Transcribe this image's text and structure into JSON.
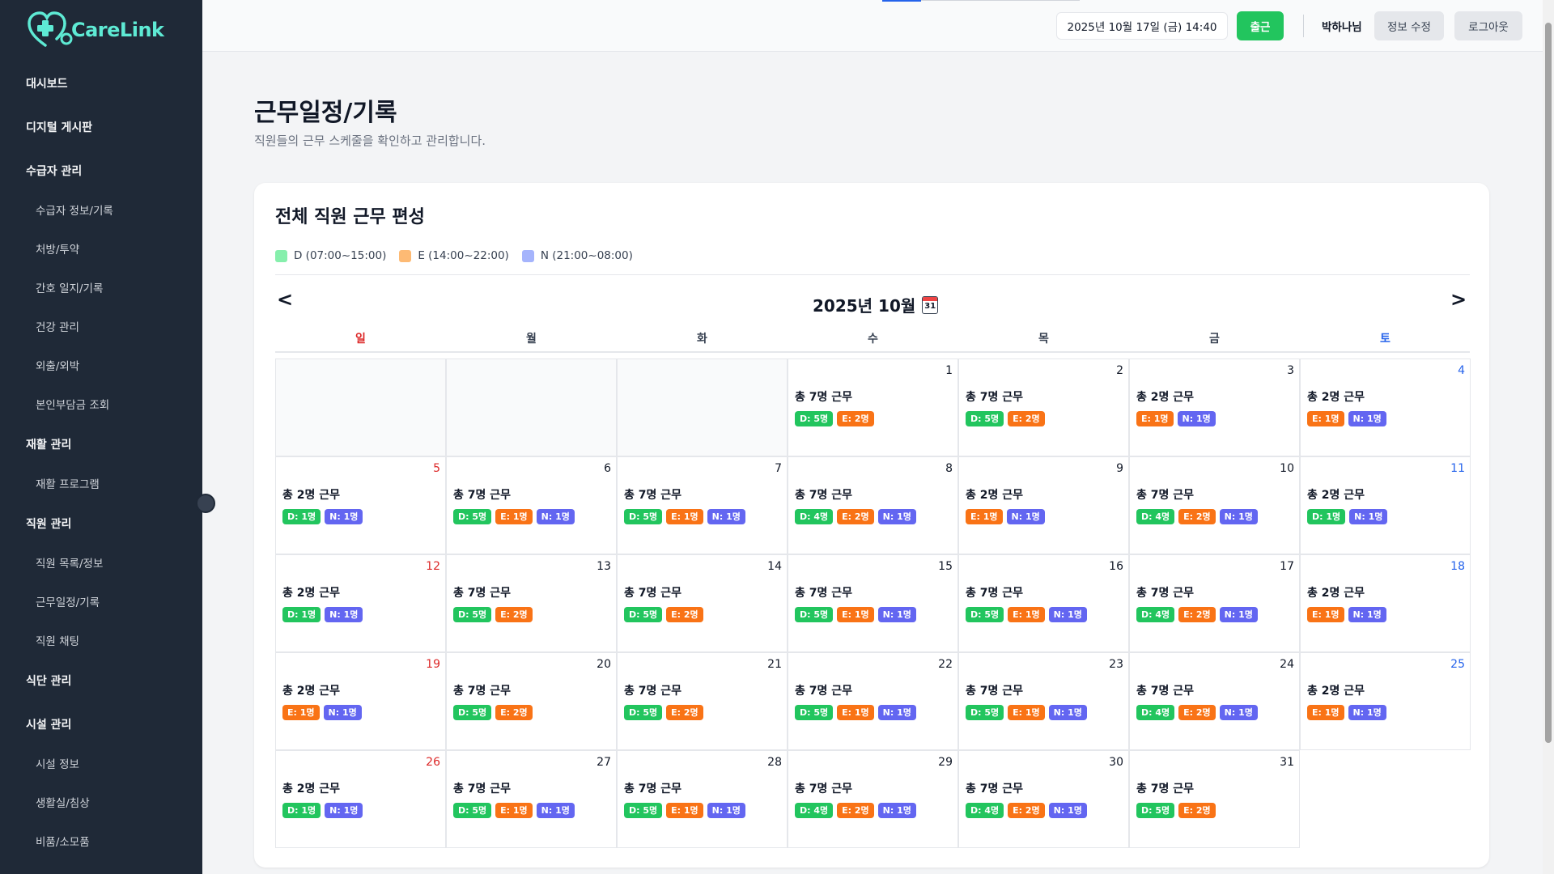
{
  "app": {
    "logo_text": "CareLink"
  },
  "sidebar": {
    "items": [
      {
        "label": "대시보드",
        "level": "top"
      },
      {
        "label": "디지털 게시판",
        "level": "top"
      },
      {
        "label": "수급자 관리",
        "level": "top"
      },
      {
        "label": "수급자 정보/기록",
        "level": "sub"
      },
      {
        "label": "처방/투약",
        "level": "sub"
      },
      {
        "label": "간호 일지/기록",
        "level": "sub"
      },
      {
        "label": "건강 관리",
        "level": "sub"
      },
      {
        "label": "외출/외박",
        "level": "sub"
      },
      {
        "label": "본인부담금 조회",
        "level": "sub"
      },
      {
        "label": "재활 관리",
        "level": "top"
      },
      {
        "label": "재활 프로그램",
        "level": "sub"
      },
      {
        "label": "직원 관리",
        "level": "top"
      },
      {
        "label": "직원 목록/정보",
        "level": "sub"
      },
      {
        "label": "근무일정/기록",
        "level": "sub"
      },
      {
        "label": "직원 채팅",
        "level": "sub"
      },
      {
        "label": "식단 관리",
        "level": "top"
      },
      {
        "label": "시설 관리",
        "level": "top"
      },
      {
        "label": "시설 정보",
        "level": "sub"
      },
      {
        "label": "생활실/침상",
        "level": "sub"
      },
      {
        "label": "비품/소모품",
        "level": "sub"
      }
    ]
  },
  "header": {
    "datetime": "2025년 10월 17일 (금) 14:40",
    "checkin_label": "출근",
    "username": "박하나님",
    "edit_label": "정보 수정",
    "logout_label": "로그아웃"
  },
  "page": {
    "title": "근무일정/기록",
    "subtitle": "직원들의 근무 스케줄을 확인하고 관리합니다."
  },
  "schedule": {
    "card_title": "전체 직원 근무 편성",
    "legend": [
      {
        "label": "D (07:00~15:00)",
        "color": "#86efac"
      },
      {
        "label": "E (14:00~22:00)",
        "color": "#fdba74"
      },
      {
        "label": "N (21:00~08:00)",
        "color": "#a5b4fc"
      }
    ],
    "prev_label": "<",
    "next_label": ">",
    "month_title": "2025년 10월",
    "calendar_icon_num": "31",
    "weekdays": [
      {
        "label": "일",
        "color": "#dc2626"
      },
      {
        "label": "월",
        "color": "#374151"
      },
      {
        "label": "화",
        "color": "#374151"
      },
      {
        "label": "수",
        "color": "#374151"
      },
      {
        "label": "목",
        "color": "#374151"
      },
      {
        "label": "금",
        "color": "#374151"
      },
      {
        "label": "토",
        "color": "#2563eb"
      }
    ],
    "badge_colors": {
      "D": "#22c55e",
      "E": "#f97316",
      "N": "#6366f1"
    },
    "day_colors": {
      "sun": "#dc2626",
      "sat": "#2563eb",
      "weekday": "#111827"
    },
    "leading_empty": 3,
    "days": [
      {
        "day": "1",
        "total": "총 7명 근무",
        "shifts": [
          [
            "D",
            "D: 5명"
          ],
          [
            "E",
            "E: 2명"
          ]
        ]
      },
      {
        "day": "2",
        "total": "총 7명 근무",
        "shifts": [
          [
            "D",
            "D: 5명"
          ],
          [
            "E",
            "E: 2명"
          ]
        ]
      },
      {
        "day": "3",
        "total": "총 2명 근무",
        "shifts": [
          [
            "E",
            "E: 1명"
          ],
          [
            "N",
            "N: 1명"
          ]
        ]
      },
      {
        "day": "4",
        "total": "총 2명 근무",
        "shifts": [
          [
            "E",
            "E: 1명"
          ],
          [
            "N",
            "N: 1명"
          ]
        ]
      },
      {
        "day": "5",
        "total": "총 2명 근무",
        "shifts": [
          [
            "D",
            "D: 1명"
          ],
          [
            "N",
            "N: 1명"
          ]
        ]
      },
      {
        "day": "6",
        "total": "총 7명 근무",
        "shifts": [
          [
            "D",
            "D: 5명"
          ],
          [
            "E",
            "E: 1명"
          ],
          [
            "N",
            "N: 1명"
          ]
        ]
      },
      {
        "day": "7",
        "total": "총 7명 근무",
        "shifts": [
          [
            "D",
            "D: 5명"
          ],
          [
            "E",
            "E: 1명"
          ],
          [
            "N",
            "N: 1명"
          ]
        ]
      },
      {
        "day": "8",
        "total": "총 7명 근무",
        "shifts": [
          [
            "D",
            "D: 4명"
          ],
          [
            "E",
            "E: 2명"
          ],
          [
            "N",
            "N: 1명"
          ]
        ]
      },
      {
        "day": "9",
        "total": "총 2명 근무",
        "shifts": [
          [
            "E",
            "E: 1명"
          ],
          [
            "N",
            "N: 1명"
          ]
        ]
      },
      {
        "day": "10",
        "total": "총 7명 근무",
        "shifts": [
          [
            "D",
            "D: 4명"
          ],
          [
            "E",
            "E: 2명"
          ],
          [
            "N",
            "N: 1명"
          ]
        ]
      },
      {
        "day": "11",
        "total": "총 2명 근무",
        "shifts": [
          [
            "D",
            "D: 1명"
          ],
          [
            "N",
            "N: 1명"
          ]
        ]
      },
      {
        "day": "12",
        "total": "총 2명 근무",
        "shifts": [
          [
            "D",
            "D: 1명"
          ],
          [
            "N",
            "N: 1명"
          ]
        ]
      },
      {
        "day": "13",
        "total": "총 7명 근무",
        "shifts": [
          [
            "D",
            "D: 5명"
          ],
          [
            "E",
            "E: 2명"
          ]
        ]
      },
      {
        "day": "14",
        "total": "총 7명 근무",
        "shifts": [
          [
            "D",
            "D: 5명"
          ],
          [
            "E",
            "E: 2명"
          ]
        ]
      },
      {
        "day": "15",
        "total": "총 7명 근무",
        "shifts": [
          [
            "D",
            "D: 5명"
          ],
          [
            "E",
            "E: 1명"
          ],
          [
            "N",
            "N: 1명"
          ]
        ]
      },
      {
        "day": "16",
        "total": "총 7명 근무",
        "shifts": [
          [
            "D",
            "D: 5명"
          ],
          [
            "E",
            "E: 1명"
          ],
          [
            "N",
            "N: 1명"
          ]
        ]
      },
      {
        "day": "17",
        "total": "총 7명 근무",
        "shifts": [
          [
            "D",
            "D: 4명"
          ],
          [
            "E",
            "E: 2명"
          ],
          [
            "N",
            "N: 1명"
          ]
        ]
      },
      {
        "day": "18",
        "total": "총 2명 근무",
        "shifts": [
          [
            "E",
            "E: 1명"
          ],
          [
            "N",
            "N: 1명"
          ]
        ]
      },
      {
        "day": "19",
        "total": "총 2명 근무",
        "shifts": [
          [
            "E",
            "E: 1명"
          ],
          [
            "N",
            "N: 1명"
          ]
        ]
      },
      {
        "day": "20",
        "total": "총 7명 근무",
        "shifts": [
          [
            "D",
            "D: 5명"
          ],
          [
            "E",
            "E: 2명"
          ]
        ]
      },
      {
        "day": "21",
        "total": "총 7명 근무",
        "shifts": [
          [
            "D",
            "D: 5명"
          ],
          [
            "E",
            "E: 2명"
          ]
        ]
      },
      {
        "day": "22",
        "total": "총 7명 근무",
        "shifts": [
          [
            "D",
            "D: 5명"
          ],
          [
            "E",
            "E: 1명"
          ],
          [
            "N",
            "N: 1명"
          ]
        ]
      },
      {
        "day": "23",
        "total": "총 7명 근무",
        "shifts": [
          [
            "D",
            "D: 5명"
          ],
          [
            "E",
            "E: 1명"
          ],
          [
            "N",
            "N: 1명"
          ]
        ]
      },
      {
        "day": "24",
        "total": "총 7명 근무",
        "shifts": [
          [
            "D",
            "D: 4명"
          ],
          [
            "E",
            "E: 2명"
          ],
          [
            "N",
            "N: 1명"
          ]
        ]
      },
      {
        "day": "25",
        "total": "총 2명 근무",
        "shifts": [
          [
            "E",
            "E: 1명"
          ],
          [
            "N",
            "N: 1명"
          ]
        ]
      },
      {
        "day": "26",
        "total": "총 2명 근무",
        "shifts": [
          [
            "D",
            "D: 1명"
          ],
          [
            "N",
            "N: 1명"
          ]
        ]
      },
      {
        "day": "27",
        "total": "총 7명 근무",
        "shifts": [
          [
            "D",
            "D: 5명"
          ],
          [
            "E",
            "E: 1명"
          ],
          [
            "N",
            "N: 1명"
          ]
        ]
      },
      {
        "day": "28",
        "total": "총 7명 근무",
        "shifts": [
          [
            "D",
            "D: 5명"
          ],
          [
            "E",
            "E: 1명"
          ],
          [
            "N",
            "N: 1명"
          ]
        ]
      },
      {
        "day": "29",
        "total": "총 7명 근무",
        "shifts": [
          [
            "D",
            "D: 4명"
          ],
          [
            "E",
            "E: 2명"
          ],
          [
            "N",
            "N: 1명"
          ]
        ]
      },
      {
        "day": "30",
        "total": "총 7명 근무",
        "shifts": [
          [
            "D",
            "D: 4명"
          ],
          [
            "E",
            "E: 2명"
          ],
          [
            "N",
            "N: 1명"
          ]
        ]
      },
      {
        "day": "31",
        "total": "총 7명 근무",
        "shifts": [
          [
            "D",
            "D: 5명"
          ],
          [
            "E",
            "E: 2명"
          ]
        ]
      }
    ]
  }
}
